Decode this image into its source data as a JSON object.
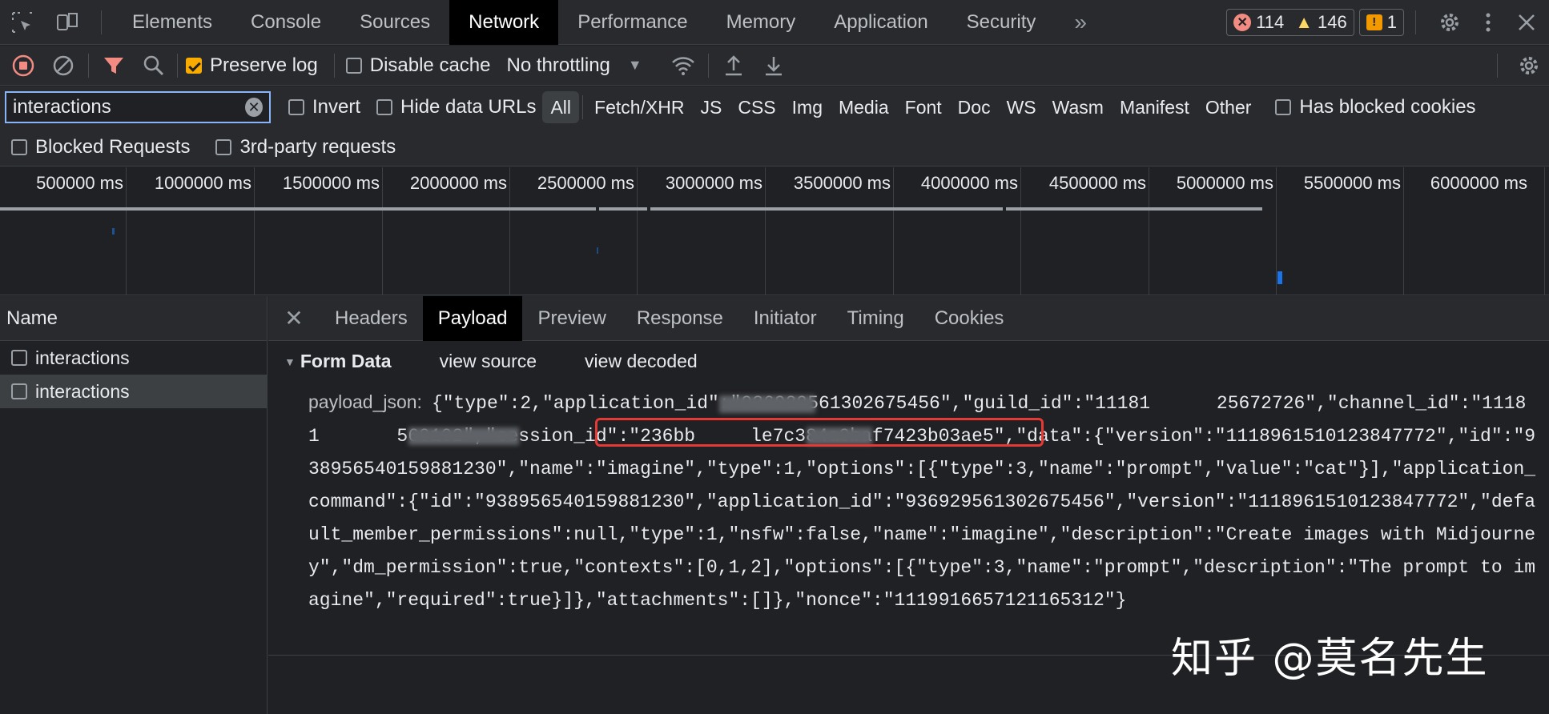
{
  "tabbar": {
    "tabs": [
      "Elements",
      "Console",
      "Sources",
      "Network",
      "Performance",
      "Memory",
      "Application",
      "Security"
    ],
    "active_tab": "Network",
    "more": "»",
    "errors": "114",
    "warnings": "146",
    "issues": "1"
  },
  "toolbar": {
    "preserve_log": "Preserve log",
    "disable_cache": "Disable cache",
    "throttling": "No throttling"
  },
  "filter": {
    "search_value": "interactions",
    "invert": "Invert",
    "hide_data_urls": "Hide data URLs",
    "types": [
      "All",
      "Fetch/XHR",
      "JS",
      "CSS",
      "Img",
      "Media",
      "Font",
      "Doc",
      "WS",
      "Wasm",
      "Manifest",
      "Other"
    ],
    "active_type": "All",
    "has_blocked_cookies": "Has blocked cookies",
    "blocked_requests": "Blocked Requests",
    "third_party": "3rd-party requests"
  },
  "timeline": {
    "ticks": [
      "500000 ms",
      "1000000 ms",
      "1500000 ms",
      "2000000 ms",
      "2500000 ms",
      "3000000 ms",
      "3500000 ms",
      "4000000 ms",
      "4500000 ms",
      "5000000 ms",
      "5500000 ms",
      "6000000 ms"
    ]
  },
  "requests": {
    "header": "Name",
    "rows": [
      "interactions",
      "interactions"
    ]
  },
  "detail": {
    "tabs": [
      "Headers",
      "Payload",
      "Preview",
      "Response",
      "Initiator",
      "Timing",
      "Cookies"
    ],
    "active_tab": "Payload",
    "form_data": "Form Data",
    "view_source": "view source",
    "view_decoded": "view decoded",
    "payload_key": "payload_json:",
    "payload_value": "{\"type\":2,\"application_id\":\"936929561302675456\",\"guild_id\":\"11181      25672726\",\"channel_id\":\"11181       560102\",\"session_id\":\"236bb     le7c384a9baf7423b03ae5\",\"data\":{\"version\":\"1118961510123847772\",\"id\":\"938956540159881230\",\"name\":\"imagine\",\"type\":1,\"options\":[{\"type\":3,\"name\":\"prompt\",\"value\":\"cat\"}],\"application_command\":{\"id\":\"938956540159881230\",\"application_id\":\"936929561302675456\",\"version\":\"1118961510123847772\",\"default_member_permissions\":null,\"type\":1,\"nsfw\":false,\"name\":\"imagine\",\"description\":\"Create images with Midjourney\",\"dm_permission\":true,\"contexts\":[0,1,2],\"options\":[{\"type\":3,\"name\":\"prompt\",\"description\":\"The prompt to imagine\",\"required\":true}]},\"attachments\":[]},\"nonce\":\"1119916657121165312\"}"
  },
  "watermark": "知乎 @莫名先生"
}
